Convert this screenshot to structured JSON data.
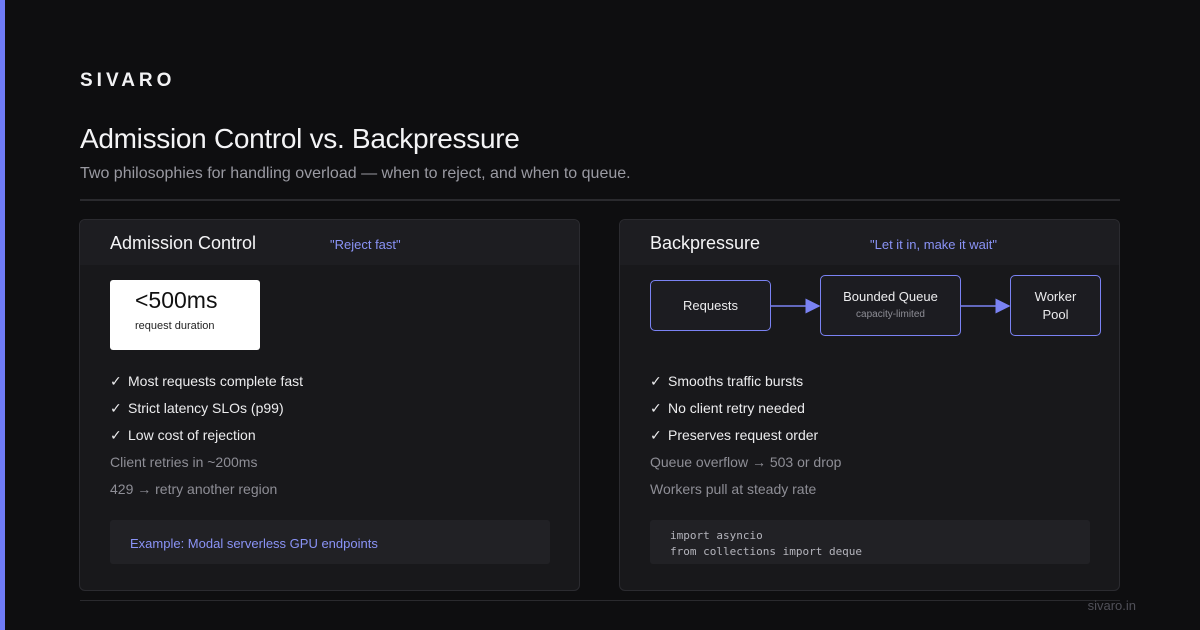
{
  "brand": "SIVARO",
  "title": "Admission Control vs. Backpressure",
  "subtitle": "Two philosophies for handling overload — when to reject, and when to queue.",
  "footer": "sivaro.in",
  "colors": {
    "background": "#0e0e10",
    "accent": "#6f7bf7",
    "card": "#18181b",
    "tag": "#8a93f6"
  },
  "left": {
    "title": "Admission Control",
    "tag": "\"Reject fast\"",
    "stat": {
      "value": "<500ms",
      "label": "request duration"
    },
    "items": [
      {
        "type": "check",
        "mark": "✓",
        "text": "Most requests complete fast"
      },
      {
        "type": "check",
        "mark": "✓",
        "text": "Strict latency SLOs (p99)"
      },
      {
        "type": "check",
        "mark": "✓",
        "text": "Low cost of rejection"
      },
      {
        "type": "plain",
        "mark": "",
        "text": "Client retries in ~200ms"
      },
      {
        "type": "plain",
        "mark": "",
        "text": "429 → retry another region"
      }
    ],
    "example": "Example: Modal serverless GPU endpoints"
  },
  "right": {
    "title": "Backpressure",
    "tag": "\"Let it in, make it wait\"",
    "diagram": {
      "nodes": [
        {
          "title": "Requests",
          "sub": ""
        },
        {
          "title": "Bounded Queue",
          "sub": "capacity-limited"
        },
        {
          "title": "Worker Pool",
          "sub": ""
        }
      ],
      "edges": [
        [
          "Requests",
          "Bounded Queue"
        ],
        [
          "Bounded Queue",
          "Worker Pool"
        ]
      ]
    },
    "items": [
      {
        "type": "check",
        "mark": "✓",
        "text": "Smooths traffic bursts"
      },
      {
        "type": "check",
        "mark": "✓",
        "text": "No client retry needed"
      },
      {
        "type": "check",
        "mark": "✓",
        "text": "Preserves request order"
      },
      {
        "type": "plain",
        "mark": "",
        "text": "Queue overflow → 503 or drop"
      },
      {
        "type": "plain",
        "mark": "",
        "text": "Workers pull at steady rate"
      }
    ],
    "code": [
      "import asyncio",
      "from collections import deque"
    ]
  }
}
